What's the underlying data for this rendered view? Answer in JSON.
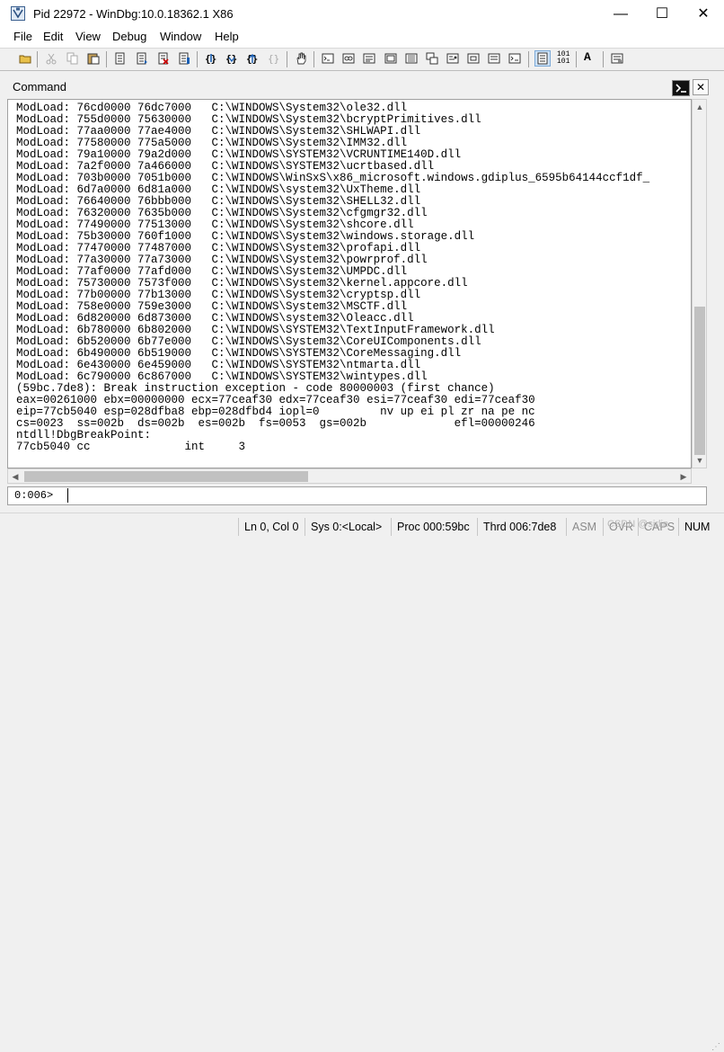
{
  "window": {
    "title": "Pid 22972 - WinDbg:10.0.18362.1 X86",
    "minimize_glyph": "—",
    "maximize_glyph": "☐",
    "close_glyph": "✕"
  },
  "menu": [
    "File",
    "Edit",
    "View",
    "Debug",
    "Window",
    "Help"
  ],
  "toolbar": {
    "binary_label": "101\n101",
    "font_label": "A"
  },
  "panel": {
    "title": "Command",
    "close_glyph": "✕"
  },
  "output": [
    "ModLoad: 76cd0000 76dc7000   C:\\WINDOWS\\System32\\ole32.dll",
    "ModLoad: 755d0000 75630000   C:\\WINDOWS\\System32\\bcryptPrimitives.dll",
    "ModLoad: 77aa0000 77ae4000   C:\\WINDOWS\\System32\\SHLWAPI.dll",
    "ModLoad: 77580000 775a5000   C:\\WINDOWS\\System32\\IMM32.dll",
    "ModLoad: 79a10000 79a2d000   C:\\WINDOWS\\SYSTEM32\\VCRUNTIME140D.dll",
    "ModLoad: 7a2f0000 7a466000   C:\\WINDOWS\\SYSTEM32\\ucrtbased.dll",
    "ModLoad: 703b0000 7051b000   C:\\WINDOWS\\WinSxS\\x86_microsoft.windows.gdiplus_6595b64144ccf1df_",
    "ModLoad: 6d7a0000 6d81a000   C:\\WINDOWS\\system32\\UxTheme.dll",
    "ModLoad: 76640000 76bbb000   C:\\WINDOWS\\System32\\SHELL32.dll",
    "ModLoad: 76320000 7635b000   C:\\WINDOWS\\System32\\cfgmgr32.dll",
    "ModLoad: 77490000 77513000   C:\\WINDOWS\\System32\\shcore.dll",
    "ModLoad: 75b30000 760f1000   C:\\WINDOWS\\System32\\windows.storage.dll",
    "ModLoad: 77470000 77487000   C:\\WINDOWS\\System32\\profapi.dll",
    "ModLoad: 77a30000 77a73000   C:\\WINDOWS\\System32\\powrprof.dll",
    "ModLoad: 77af0000 77afd000   C:\\WINDOWS\\System32\\UMPDC.dll",
    "ModLoad: 75730000 7573f000   C:\\WINDOWS\\System32\\kernel.appcore.dll",
    "ModLoad: 77b00000 77b13000   C:\\WINDOWS\\System32\\cryptsp.dll",
    "ModLoad: 758e0000 759e3000   C:\\WINDOWS\\System32\\MSCTF.dll",
    "ModLoad: 6d820000 6d873000   C:\\WINDOWS\\system32\\Oleacc.dll",
    "ModLoad: 6b780000 6b802000   C:\\WINDOWS\\SYSTEM32\\TextInputFramework.dll",
    "ModLoad: 6b520000 6b77e000   C:\\WINDOWS\\System32\\CoreUIComponents.dll",
    "ModLoad: 6b490000 6b519000   C:\\WINDOWS\\SYSTEM32\\CoreMessaging.dll",
    "ModLoad: 6e430000 6e459000   C:\\WINDOWS\\SYSTEM32\\ntmarta.dll",
    "ModLoad: 6c790000 6c867000   C:\\WINDOWS\\SYSTEM32\\wintypes.dll",
    "(59bc.7de8): Break instruction exception - code 80000003 (first chance)",
    "eax=00261000 ebx=00000000 ecx=77ceaf30 edx=77ceaf30 esi=77ceaf30 edi=77ceaf30",
    "eip=77cb5040 esp=028dfba8 ebp=028dfbd4 iopl=0         nv up ei pl zr na pe nc",
    "cs=0023  ss=002b  ds=002b  es=002b  fs=0053  gs=002b             efl=00000246",
    "ntdll!DbgBreakPoint:",
    "77cb5040 cc              int     3"
  ],
  "command": {
    "prompt": "0:006>",
    "value": ""
  },
  "status": {
    "line_col": "Ln 0, Col 0",
    "sys": "Sys 0:<Local>",
    "proc": "Proc 000:59bc",
    "thrd": "Thrd 006:7de8",
    "asm": "ASM",
    "ovr": "OVR",
    "caps": "CAPS",
    "num": "NUM"
  },
  "watermark": "CSDN @sirlin"
}
